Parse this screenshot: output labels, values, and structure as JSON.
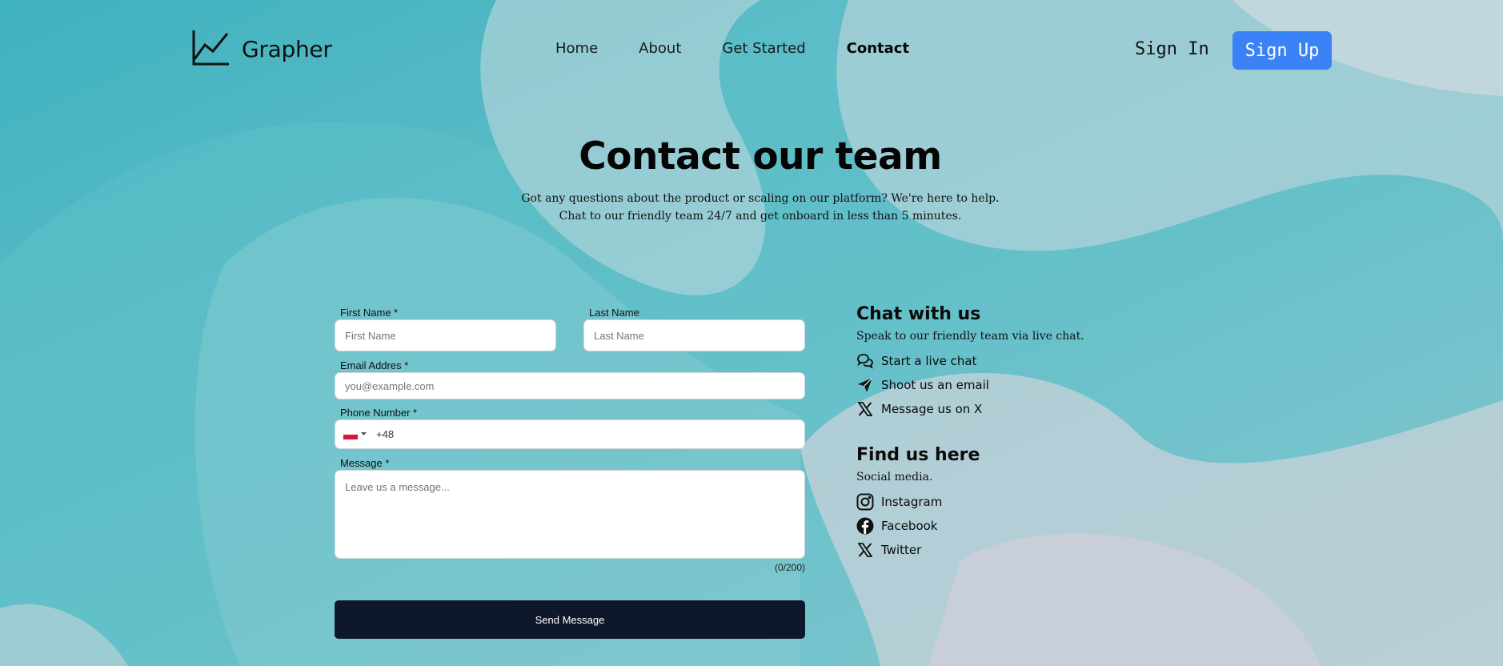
{
  "brand": {
    "name": "Grapher",
    "icon": "line-chart-icon"
  },
  "nav": {
    "links": [
      "Home",
      "About",
      "Get Started",
      "Contact"
    ],
    "active": "Contact",
    "sign_in": "Sign In",
    "sign_up": "Sign Up"
  },
  "hero": {
    "title": "Contact our team",
    "line1": "Got any questions about the product or scaling on our platform? We're here to help.",
    "line2": "Chat to our friendly team 24/7 and get onboard in less than 5 minutes."
  },
  "form": {
    "first_name": {
      "label": "First Name *",
      "placeholder": "First Name"
    },
    "last_name": {
      "label": "Last Name",
      "placeholder": "Last Name"
    },
    "email": {
      "label": "Email Addres *",
      "placeholder": "you@example.com"
    },
    "phone": {
      "label": "Phone Number *",
      "value": "+48",
      "flag": "poland-flag-icon"
    },
    "message": {
      "label": "Message *",
      "placeholder": "Leave us a message..."
    },
    "counter": "(0/200)",
    "submit": "Send Message"
  },
  "chat": {
    "title": "Chat with us",
    "subtitle": "Speak to our friendly team via live chat.",
    "items": [
      {
        "label": "Start a live chat",
        "icon": "chat-bubbles-icon"
      },
      {
        "label": "Shoot us an email",
        "icon": "paper-plane-icon"
      },
      {
        "label": "Message us on X",
        "icon": "x-logo-icon"
      }
    ]
  },
  "find": {
    "title": "Find us here",
    "subtitle": "Social media.",
    "items": [
      {
        "label": "Instagram",
        "icon": "instagram-icon"
      },
      {
        "label": "Facebook",
        "icon": "facebook-icon"
      },
      {
        "label": "Twitter",
        "icon": "x-logo-icon"
      }
    ]
  },
  "colors": {
    "primary": "#3b82f6",
    "button_dark": "#0f172a",
    "background_teal": "#4fb8c3",
    "background_light": "#cfd6dc"
  }
}
